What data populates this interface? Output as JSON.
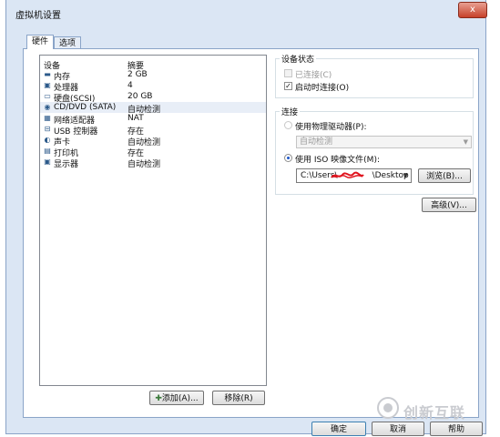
{
  "window": {
    "title": "虚拟机设置",
    "close_label": "x"
  },
  "tabs": [
    {
      "label": "硬件"
    },
    {
      "label": "选项"
    }
  ],
  "device_list": {
    "columns": {
      "device": "设备",
      "summary": "摘要"
    },
    "rows": [
      {
        "icon": "memory-icon",
        "glyph": "▬",
        "name": "内存",
        "summary": "2 GB"
      },
      {
        "icon": "processor-icon",
        "glyph": "▣",
        "name": "处理器",
        "summary": "4"
      },
      {
        "icon": "hard-disk-icon",
        "glyph": "▭",
        "name": "硬盘(SCSI)",
        "summary": "20 GB"
      },
      {
        "icon": "cd-dvd-icon",
        "glyph": "◉",
        "name": "CD/DVD (SATA)",
        "summary": "自动检测",
        "selected": true
      },
      {
        "icon": "network-adapter-icon",
        "glyph": "▦",
        "name": "网络适配器",
        "summary": "NAT"
      },
      {
        "icon": "usb-icon",
        "glyph": "⊟",
        "name": "USB 控制器",
        "summary": "存在"
      },
      {
        "icon": "sound-card-icon",
        "glyph": "◐",
        "name": "声卡",
        "summary": "自动检测"
      },
      {
        "icon": "printer-icon",
        "glyph": "▤",
        "name": "打印机",
        "summary": "存在"
      },
      {
        "icon": "display-icon",
        "glyph": "▣",
        "name": "显示器",
        "summary": "自动检测"
      }
    ]
  },
  "buttons": {
    "add": "添加(A)...",
    "remove": "移除(R)",
    "ok": "确定",
    "cancel": "取消",
    "help": "帮助",
    "browse": "浏览(B)...",
    "advanced": "高级(V)..."
  },
  "device_status": {
    "title": "设备状态",
    "connected": {
      "label": "已连接(C)",
      "checked": false,
      "disabled": true
    },
    "connect_at_power_on": {
      "label": "启动时连接(O)",
      "checked": true
    }
  },
  "connection": {
    "title": "连接",
    "physical_drive": {
      "label": "使用物理驱动器(P):",
      "selected": false
    },
    "physical_drive_select": "自动检测",
    "iso_image": {
      "label": "使用 ISO 映像文件(M):",
      "selected": true
    },
    "iso_path": "C:\\Users\\",
    "iso_path_tail": "\\Desktop"
  },
  "watermark": {
    "text": "创新互联"
  }
}
